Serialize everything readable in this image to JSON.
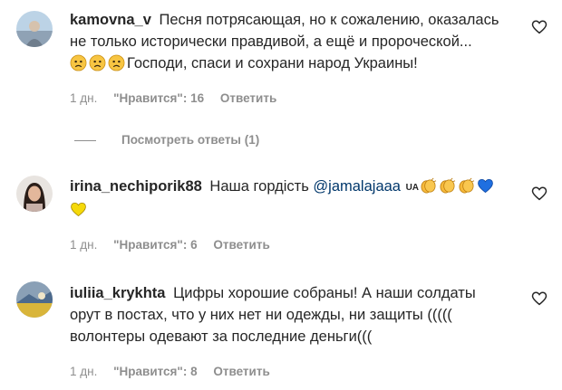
{
  "comments": [
    {
      "username": "kamovna_v",
      "text_line1": "Песня потрясающая, но к сожалению, оказалась",
      "text_line2": "не только исторически правдивой, а ещё и пророческой...",
      "text_line3": "Господи, спаси и сохрани народ Украины!",
      "emojis": [
        "sad-face",
        "sad-face",
        "sad-face"
      ],
      "time": "1 дн.",
      "likes": "\"Нравится\": 16",
      "reply": "Ответить"
    },
    {
      "username": "irina_nechiporik88",
      "text": "Наша гордість",
      "mention": "@jamalajaaa",
      "flag_text": "UA",
      "emojis": [
        "clapping-hands",
        "clapping-hands",
        "clapping-hands",
        "blue-heart",
        "yellow-heart"
      ],
      "time": "1 дн.",
      "likes": "\"Нравится\": 6",
      "reply": "Ответить"
    },
    {
      "username": "iuliia_krykhta",
      "text_line1": "Цифры хорошие собраны! А наши солдаты",
      "text_line2": "орут в постах, что у них нет ни одежды, ни защиты (((((",
      "text_line3": "волонтеры одевают за последние деньги(((",
      "time": "1 дн.",
      "likes": "\"Нравится\": 8",
      "reply": "Ответить"
    }
  ],
  "view_replies": "Посмотреть ответы (1)",
  "colors": {
    "text": "#262626",
    "muted": "#8e8e8e",
    "mention": "#00376b",
    "blue_heart": "#1f6fe0",
    "yellow_heart": "#f5d90a"
  }
}
